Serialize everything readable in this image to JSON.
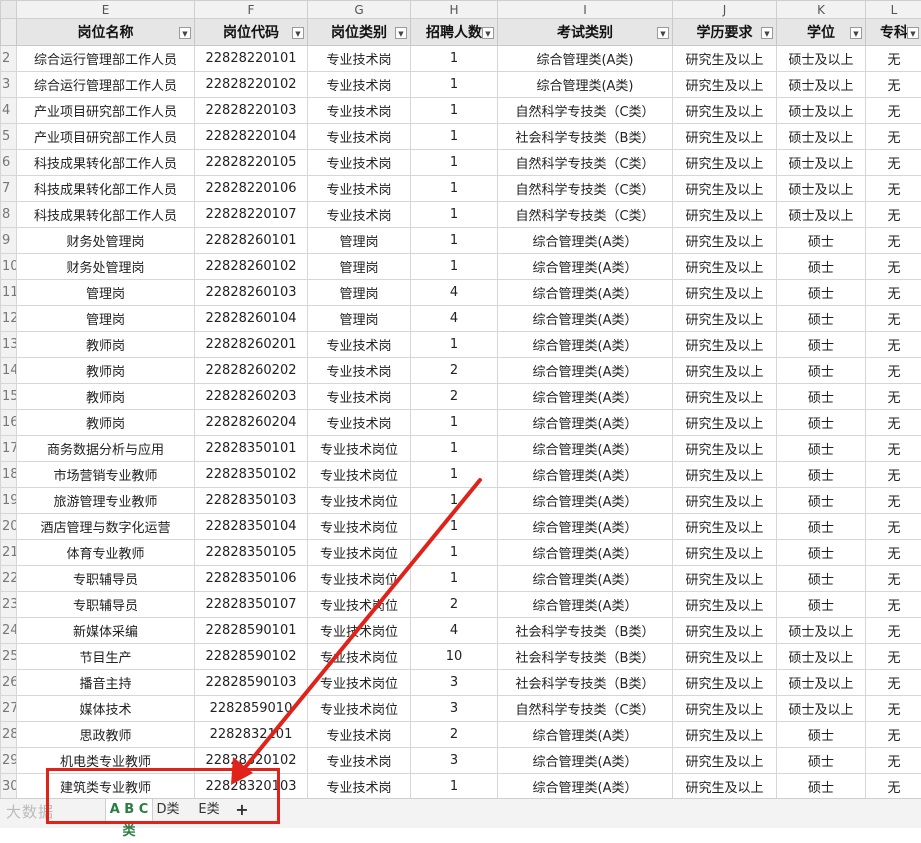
{
  "columns": {
    "letters": [
      "E",
      "F",
      "G",
      "H",
      "I",
      "J",
      "K",
      "L"
    ],
    "headers": [
      "岗位名称",
      "岗位代码",
      "岗位类别",
      "招聘人数",
      "考试类别",
      "学历要求",
      "学位",
      "专科"
    ],
    "filter_icon": "dropdown-filter-icon"
  },
  "row_numbers": [
    "2",
    "3",
    "4",
    "5",
    "6",
    "7",
    "8",
    "9",
    "10",
    "11",
    "12",
    "13",
    "14",
    "15",
    "16",
    "17",
    "18",
    "19",
    "20",
    "21",
    "22",
    "23",
    "24",
    "25",
    "26",
    "27",
    "28",
    "29",
    "30"
  ],
  "rows": [
    [
      "综合运行管理部工作人员",
      "22828220101",
      "专业技术岗",
      "1",
      "综合管理类(A类)",
      "研究生及以上",
      "硕士及以上",
      "无"
    ],
    [
      "综合运行管理部工作人员",
      "22828220102",
      "专业技术岗",
      "1",
      "综合管理类(A类)",
      "研究生及以上",
      "硕士及以上",
      "无"
    ],
    [
      "产业项目研究部工作人员",
      "22828220103",
      "专业技术岗",
      "1",
      "自然科学专技类（C类）",
      "研究生及以上",
      "硕士及以上",
      "无"
    ],
    [
      "产业项目研究部工作人员",
      "22828220104",
      "专业技术岗",
      "1",
      "社会科学专技类（B类）",
      "研究生及以上",
      "硕士及以上",
      "无"
    ],
    [
      "科技成果转化部工作人员",
      "22828220105",
      "专业技术岗",
      "1",
      "自然科学专技类（C类）",
      "研究生及以上",
      "硕士及以上",
      "无"
    ],
    [
      "科技成果转化部工作人员",
      "22828220106",
      "专业技术岗",
      "1",
      "自然科学专技类（C类）",
      "研究生及以上",
      "硕士及以上",
      "无"
    ],
    [
      "科技成果转化部工作人员",
      "22828220107",
      "专业技术岗",
      "1",
      "自然科学专技类（C类）",
      "研究生及以上",
      "硕士及以上",
      "无"
    ],
    [
      "财务处管理岗",
      "22828260101",
      "管理岗",
      "1",
      "综合管理类(A类）",
      "研究生及以上",
      "硕士",
      "无"
    ],
    [
      "财务处管理岗",
      "22828260102",
      "管理岗",
      "1",
      "综合管理类(A类）",
      "研究生及以上",
      "硕士",
      "无"
    ],
    [
      "管理岗",
      "22828260103",
      "管理岗",
      "4",
      "综合管理类(A类）",
      "研究生及以上",
      "硕士",
      "无"
    ],
    [
      "管理岗",
      "22828260104",
      "管理岗",
      "4",
      "综合管理类(A类）",
      "研究生及以上",
      "硕士",
      "无"
    ],
    [
      "教师岗",
      "22828260201",
      "专业技术岗",
      "1",
      "综合管理类(A类）",
      "研究生及以上",
      "硕士",
      "无"
    ],
    [
      "教师岗",
      "22828260202",
      "专业技术岗",
      "2",
      "综合管理类(A类）",
      "研究生及以上",
      "硕士",
      "无"
    ],
    [
      "教师岗",
      "22828260203",
      "专业技术岗",
      "2",
      "综合管理类(A类）",
      "研究生及以上",
      "硕士",
      "无"
    ],
    [
      "教师岗",
      "22828260204",
      "专业技术岗",
      "1",
      "综合管理类(A类）",
      "研究生及以上",
      "硕士",
      "无"
    ],
    [
      "商务数据分析与应用",
      "22828350101",
      "专业技术岗位",
      "1",
      "综合管理类(A类）",
      "研究生及以上",
      "硕士",
      "无"
    ],
    [
      "市场营销专业教师",
      "22828350102",
      "专业技术岗位",
      "1",
      "综合管理类(A类）",
      "研究生及以上",
      "硕士",
      "无"
    ],
    [
      "旅游管理专业教师",
      "22828350103",
      "专业技术岗位",
      "1",
      "综合管理类(A类）",
      "研究生及以上",
      "硕士",
      "无"
    ],
    [
      "酒店管理与数字化运营",
      "22828350104",
      "专业技术岗位",
      "1",
      "综合管理类(A类）",
      "研究生及以上",
      "硕士",
      "无"
    ],
    [
      "体育专业教师",
      "22828350105",
      "专业技术岗位",
      "1",
      "综合管理类(A类）",
      "研究生及以上",
      "硕士",
      "无"
    ],
    [
      "专职辅导员",
      "22828350106",
      "专业技术岗位",
      "1",
      "综合管理类(A类）",
      "研究生及以上",
      "硕士",
      "无"
    ],
    [
      "专职辅导员",
      "22828350107",
      "专业技术岗位",
      "2",
      "综合管理类(A类）",
      "研究生及以上",
      "硕士",
      "无"
    ],
    [
      "新媒体采编",
      "22828590101",
      "专业技术岗位",
      "4",
      "社会科学专技类（B类）",
      "研究生及以上",
      "硕士及以上",
      "无"
    ],
    [
      "节目生产",
      "22828590102",
      "专业技术岗位",
      "10",
      "社会科学专技类（B类）",
      "研究生及以上",
      "硕士及以上",
      "无"
    ],
    [
      "播音主持",
      "22828590103",
      "专业技术岗位",
      "3",
      "社会科学专技类（B类）",
      "研究生及以上",
      "硕士及以上",
      "无"
    ],
    [
      "媒体技术",
      "2282859010",
      "专业技术岗位",
      "3",
      "自然科学专技类（C类）",
      "研究生及以上",
      "硕士及以上",
      "无"
    ],
    [
      "思政教师",
      "2282832101",
      "专业技术岗",
      "2",
      "综合管理类(A类）",
      "研究生及以上",
      "硕士",
      "无"
    ],
    [
      "机电类专业教师",
      "22828320102",
      "专业技术岗",
      "3",
      "综合管理类(A类）",
      "研究生及以上",
      "硕士",
      "无"
    ],
    [
      "建筑类专业教师",
      "22828320103",
      "专业技术岗",
      "1",
      "综合管理类(A类）",
      "研究生及以上",
      "硕士",
      "无"
    ]
  ],
  "tabs": [
    {
      "label": "A B C类",
      "active": true
    },
    {
      "label": "D类",
      "active": false
    },
    {
      "label": "E类",
      "active": false
    }
  ],
  "add_tab_label": "+",
  "watermark": "大数据",
  "annotation_color": "#e0231a"
}
